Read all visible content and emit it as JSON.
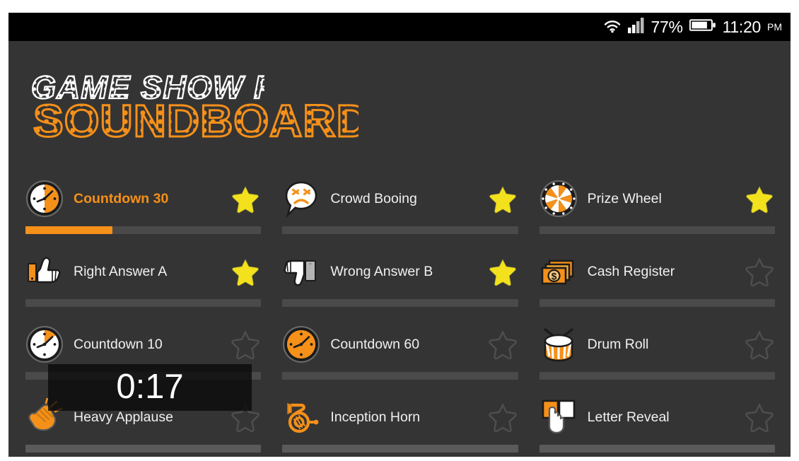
{
  "app": {
    "title_line1": "GAME SHOW FX",
    "title_line2": "SOUNDBOARD",
    "accent_color": "#f59019",
    "background_color": "#343434",
    "star_filled_color": "#f2e11c",
    "star_empty_color": "#4e4e4e"
  },
  "statusbar": {
    "wifi_icon": "wifi-icon",
    "signal_icon": "signal-bars-icon",
    "battery_percent": "77%",
    "battery_icon": "battery-icon",
    "time": "11:20",
    "ampm": "PM"
  },
  "sounds": [
    {
      "label": "Countdown 30",
      "icon": "clock-countdown-30-icon",
      "favorite": true,
      "active": true,
      "progress": 37
    },
    {
      "label": "Crowd Booing",
      "icon": "angry-face-speech-bubble-icon",
      "favorite": true,
      "active": false,
      "progress": 0
    },
    {
      "label": "Prize Wheel",
      "icon": "prize-wheel-icon",
      "favorite": true,
      "active": false,
      "progress": 0
    },
    {
      "label": "Right Answer A",
      "icon": "thumbs-up-icon",
      "favorite": true,
      "active": false,
      "progress": 0
    },
    {
      "label": "Wrong Answer B",
      "icon": "thumbs-down-icon",
      "favorite": true,
      "active": false,
      "progress": 0
    },
    {
      "label": "Cash Register",
      "icon": "money-stack-icon",
      "favorite": false,
      "active": false,
      "progress": 0
    },
    {
      "label": "Countdown 10",
      "icon": "clock-countdown-10-icon",
      "favorite": false,
      "active": false,
      "progress": 0
    },
    {
      "label": "Countdown 60",
      "icon": "clock-countdown-60-icon",
      "favorite": false,
      "active": false,
      "progress": 0
    },
    {
      "label": "Drum Roll",
      "icon": "drum-icon",
      "favorite": false,
      "active": false,
      "progress": 0
    },
    {
      "label": "Heavy Applause",
      "icon": "clapping-hands-icon",
      "favorite": false,
      "active": false,
      "progress": 0
    },
    {
      "label": "Inception Horn",
      "icon": "french-horn-icon",
      "favorite": false,
      "active": false,
      "progress": 0
    },
    {
      "label": "Letter Reveal",
      "icon": "letter-cards-hand-icon",
      "favorite": false,
      "active": false,
      "progress": 0
    }
  ],
  "toast": {
    "timer": "0:17"
  }
}
